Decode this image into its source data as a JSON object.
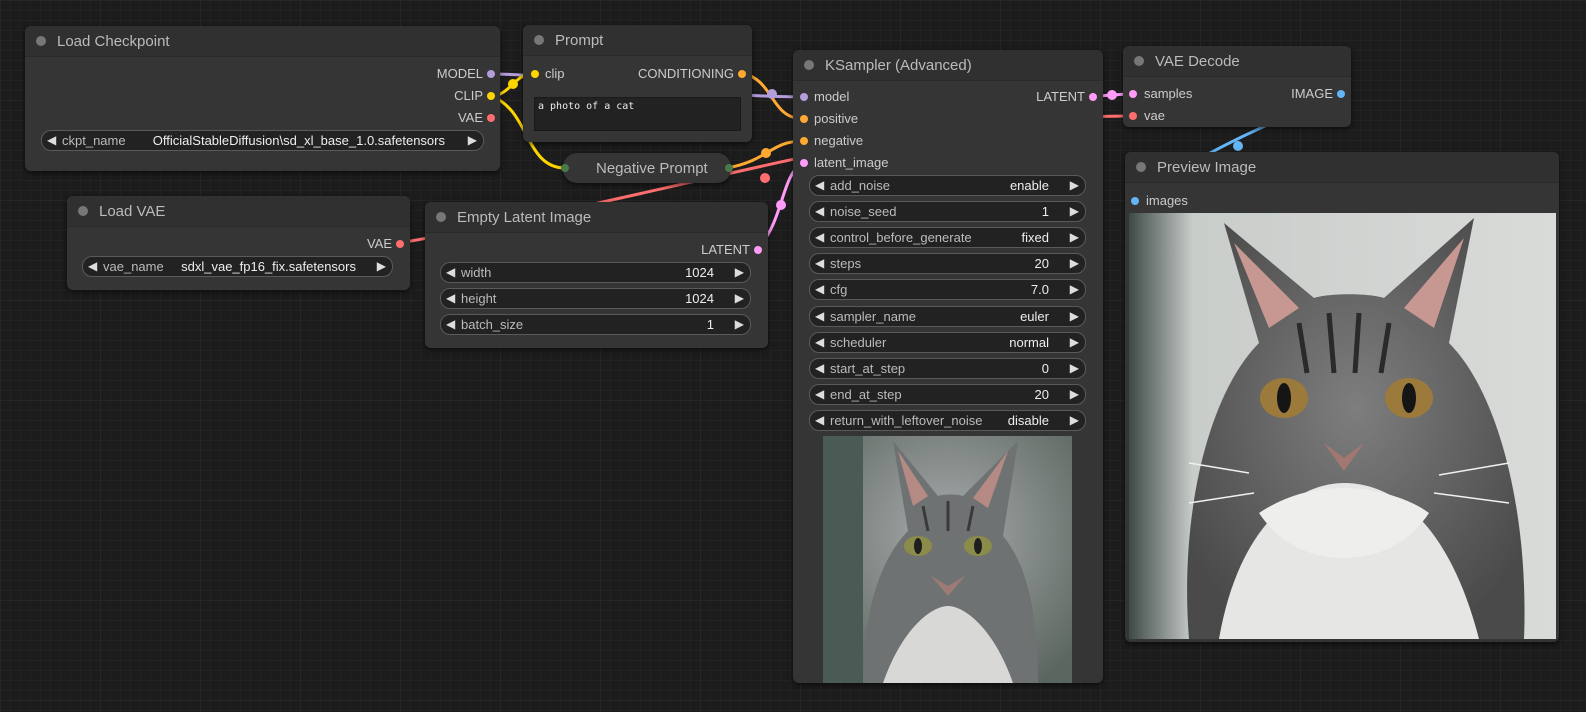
{
  "colors": {
    "model": "#b39ddb",
    "clip": "#ffd500",
    "vae": "#ff6e6e",
    "conditioning": "#ffa931",
    "latent": "#ff9cf9",
    "image": "#64b5f6",
    "neg_dot": "#4a7a4a"
  },
  "load_checkpoint": {
    "title": "Load Checkpoint",
    "outputs": [
      "MODEL",
      "CLIP",
      "VAE"
    ],
    "widget": {
      "label": "ckpt_name",
      "value": "OfficialStableDiffusion\\sd_xl_base_1.0.safetensors"
    }
  },
  "prompt": {
    "title": "Prompt",
    "input": "clip",
    "output": "CONDITIONING",
    "text": "a photo of a cat"
  },
  "negative_prompt": {
    "title": "Negative Prompt"
  },
  "load_vae": {
    "title": "Load VAE",
    "output": "VAE",
    "widget": {
      "label": "vae_name",
      "value": "sdxl_vae_fp16_fix.safetensors"
    }
  },
  "empty_latent": {
    "title": "Empty Latent Image",
    "output": "LATENT",
    "widgets": [
      {
        "label": "width",
        "value": "1024"
      },
      {
        "label": "height",
        "value": "1024"
      },
      {
        "label": "batch_size",
        "value": "1"
      }
    ]
  },
  "ksampler": {
    "title": "KSampler (Advanced)",
    "inputs": [
      "model",
      "positive",
      "negative",
      "latent_image"
    ],
    "output": "LATENT",
    "widgets": [
      {
        "label": "add_noise",
        "value": "enable"
      },
      {
        "label": "noise_seed",
        "value": "1"
      },
      {
        "label": "control_before_generate",
        "value": "fixed"
      },
      {
        "label": "steps",
        "value": "20"
      },
      {
        "label": "cfg",
        "value": "7.0"
      },
      {
        "label": "sampler_name",
        "value": "euler"
      },
      {
        "label": "scheduler",
        "value": "normal"
      },
      {
        "label": "start_at_step",
        "value": "0"
      },
      {
        "label": "end_at_step",
        "value": "20"
      },
      {
        "label": "return_with_leftover_noise",
        "value": "disable"
      }
    ]
  },
  "vae_decode": {
    "title": "VAE Decode",
    "inputs": [
      "samples",
      "vae"
    ],
    "output": "IMAGE"
  },
  "preview_image": {
    "title": "Preview Image",
    "input": "images"
  }
}
